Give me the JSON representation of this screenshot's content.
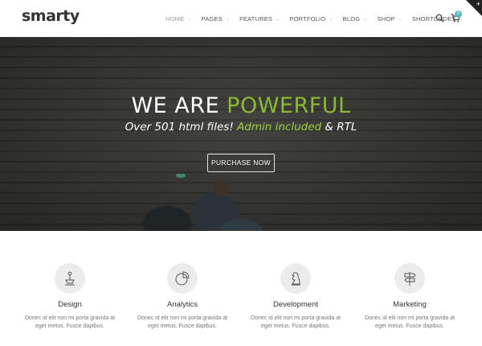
{
  "brand": {
    "logo": "smarty"
  },
  "nav": {
    "items": [
      {
        "label": "HOME",
        "active": true
      },
      {
        "label": "PAGES"
      },
      {
        "label": "FEATURES"
      },
      {
        "label": "PORTFOLIO"
      },
      {
        "label": "BLOG"
      },
      {
        "label": "SHOP"
      },
      {
        "label": "SHORTCODES"
      }
    ],
    "search_icon": "search-icon",
    "cart_icon": "cart-icon",
    "cart_count": "0"
  },
  "hero": {
    "title_part1": "WE ARE ",
    "title_accent": "POWERFUL",
    "subtitle_part1": "Over 501 html files! ",
    "subtitle_accent": "Admin included",
    "subtitle_part2": " & RTL",
    "cta_label": "PURCHASE NOW"
  },
  "features": [
    {
      "icon": "lamp-icon",
      "title": "Design",
      "desc": "Donec id elit non mi porta gravida at eget metus. Fusce dapibus."
    },
    {
      "icon": "pie-chart-icon",
      "title": "Analytics",
      "desc": "Donec id elit non mi porta gravida at eget metus. Fusce dapibus."
    },
    {
      "icon": "chess-knight-icon",
      "title": "Development",
      "desc": "Donec id elit non mi porta gravida at eget metus. Fusce dapibus."
    },
    {
      "icon": "signpost-icon",
      "title": "Marketing",
      "desc": "Donec id elit non mi porta gravida at eget metus. Fusce dapibus."
    }
  ],
  "colors": {
    "accent": "#8ab933",
    "badge": "#5ab6c6"
  }
}
